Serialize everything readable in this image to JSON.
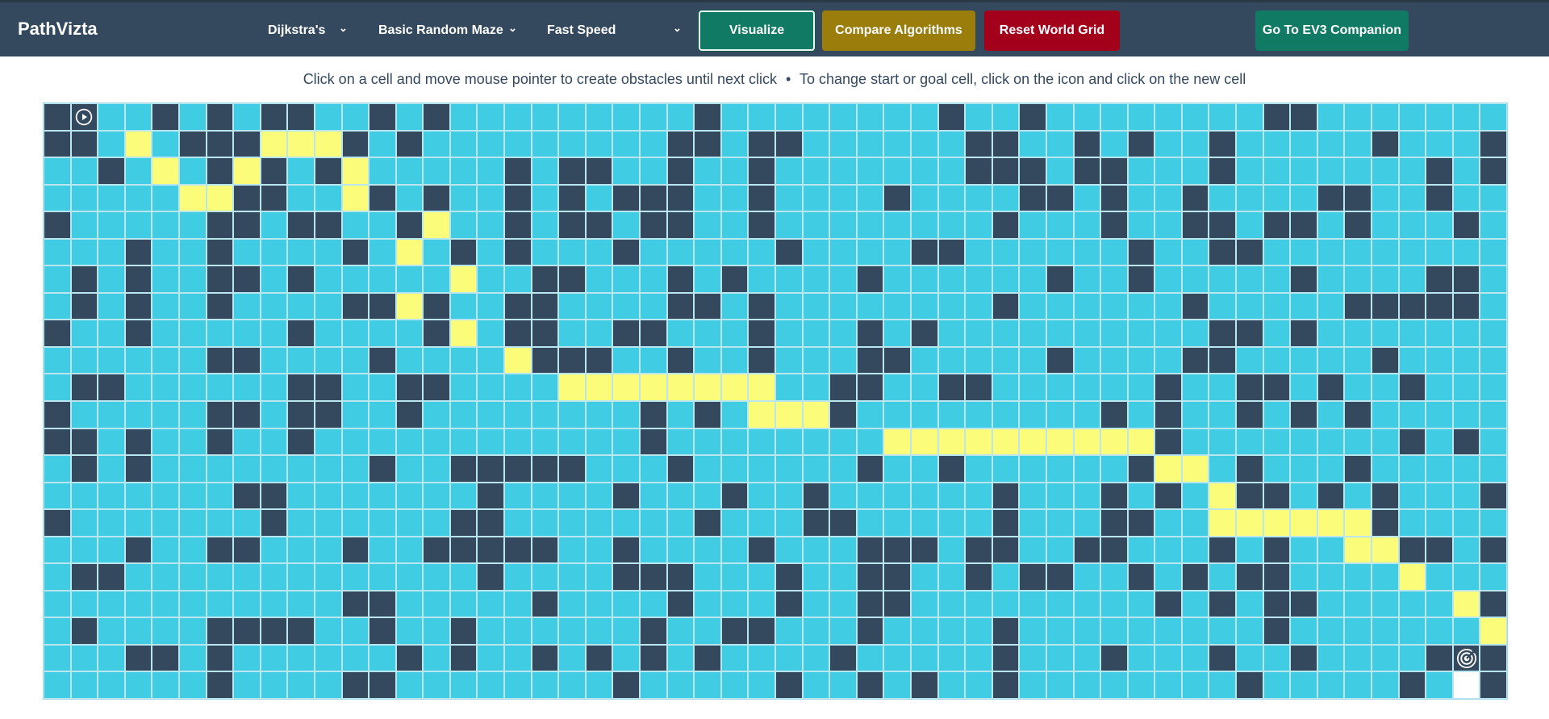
{
  "app": {
    "brand": "PathVizta"
  },
  "toolbar": {
    "algorithm": "Dijkstra's",
    "maze": "Basic Random Maze",
    "speed": "Fast Speed",
    "visualize": "Visualize",
    "compare": "Compare Algorithms",
    "reset": "Reset World Grid",
    "ev3": "Go To EV3 Companion"
  },
  "hint": {
    "text": "Click on a cell and move mouse pointer to create obstacles until next click",
    "separator": "•",
    "text2": "To change start or goal cell, click on the icon and click on the new cell"
  },
  "icons": {
    "dropdown": "chevron-down-icon",
    "start": "play-circle-icon",
    "goal": "target-icon"
  },
  "colors": {
    "navbar": "#34495e",
    "cell": "#40cde3",
    "wall": "#34495e",
    "path": "#fcfc7b",
    "visualize": "#117a65",
    "compare": "#9a7d0a",
    "reset": "#a3001c",
    "ev3": "#117a65"
  },
  "grid": {
    "cols": 54,
    "rows": 22,
    "legend": "#=wall, P=path, S=start, G=goal, V=visited, .=empty",
    "cells": [
      "#S..#.#.##..#.#.........#........#..#........##.......",
      "##.P.###PPP#.#.........##.##......##..#.#..#.....#...#",
      "..#.P.#P#.#P.....#.##..#..#.......###.##...#.......#.#",
      ".....PP##..P#.#..#.#.###..#....#....##.#..#....##..#.",
      "#.....##.##..#P..#.##.##..#........#...#..##.##.#...#.",
      "...#..#....#.P.#.#...#.....#....##......#..##.........",
      ".#.#..##.#.....P..##...#.#....#......#..#.....#....##.",
      ".#.#..#....##P#..##....##.#........#......#.....#####.",
      "#..#.....#....#P.##..##...#...#.#..........##.#.......",
      "......##....#....P###..#..#...##.....#....##.....#....",
      ".##......##..##....PPPPPPPP..##..##......#..##.#..#...",
      "#.....##.##..#........#.#.PPP#.........#.#..#.#.#.....",
      "##.#..#..#............#........PPPPPPPPPP#........#.#.",
      ".#.#........#..#####...#......#..#......#PP.#...#.....",
      ".......##.......#....#...#..#......#...#.#.P##.#.#...#",
      "#.......#......##.......#...##.....#...##..PPPPPP#....",
      "...#..##...#..#####..#....#...###.##..##...#.#..PP##.#",
      ".##.............#....###...#..##..#.##..#.#.##....P...",
      "...........##.....#....#...#..##.........#.#.##.....P#",
      ".#....####..#..#......#..##...#....#.........#.......P",
      "...##.#......#.#..#.#.#.#....#.....#...#...#..#....#G#",
      "......#....##........#.....#..#.#..#........#.....#.V#"
    ]
  }
}
